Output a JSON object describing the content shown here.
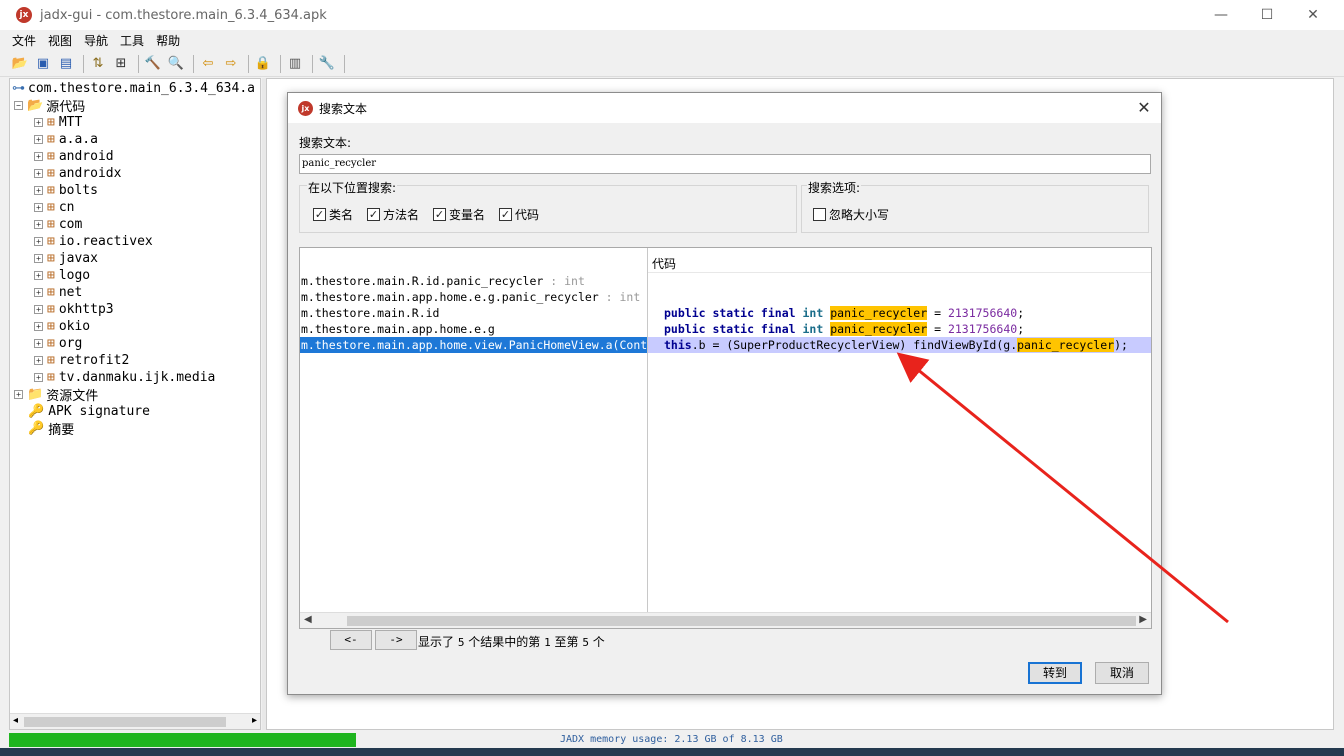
{
  "window": {
    "title": "jadx-gui - com.thestore.main_6.3.4_634.apk",
    "logo_text": "jx",
    "minimize": "—",
    "maximize": "☐",
    "close": "✕"
  },
  "menu": [
    "文件",
    "视图",
    "导航",
    "工具",
    "帮助"
  ],
  "tree": {
    "root": "com.thestore.main_6.3.4_634.a",
    "source_folder": "源代码",
    "packages": [
      "MTT",
      "a.a.a",
      "android",
      "androidx",
      "bolts",
      "cn",
      "com",
      "io.reactivex",
      "javax",
      "logo",
      "net",
      "okhttp3",
      "okio",
      "org",
      "retrofit2",
      "tv.danmaku.ijk.media"
    ],
    "resources": "资源文件",
    "apk_signature": "APK signature",
    "summary": "摘要"
  },
  "status": {
    "memory": "JADX memory usage: 2.13 GB of 8.13 GB",
    "memory_fraction": 0.262
  },
  "dialog": {
    "title": "搜索文本",
    "search_label": "搜索文本:",
    "search_value": "panic_recycler",
    "search_in_label": "在以下位置搜索:",
    "search_in": [
      {
        "label": "类名",
        "checked": true
      },
      {
        "label": "方法名",
        "checked": true
      },
      {
        "label": "变量名",
        "checked": true
      },
      {
        "label": "代码",
        "checked": true
      }
    ],
    "options_label": "搜索选项:",
    "options": [
      {
        "label": "忽略大小写",
        "checked": false
      }
    ],
    "code_column": "代码",
    "results": [
      {
        "node": "m.thestore.main.R.id.panic_recycler",
        "type": " : int"
      },
      {
        "node": "m.thestore.main.app.home.e.g.panic_recycler",
        "type": " : int"
      },
      {
        "node": "m.thestore.main.R.id",
        "type": ""
      },
      {
        "node": "m.thestore.main.app.home.e.g",
        "type": ""
      },
      {
        "node": "m.thestore.main.app.home.view.PanicHomeView.a(Cont",
        "type": ""
      }
    ],
    "code_lines": {
      "l1": {
        "kw1": "public static final",
        "ty": "int",
        "match": "panic_recycler",
        "rest": " = ",
        "num": "2131756640",
        "end": ";"
      },
      "l2": {
        "kw1": "public static final",
        "ty": "int",
        "match": "panic_recycler",
        "rest": " = ",
        "num": "2131756640",
        "end": ";"
      },
      "l3": {
        "kw": "this",
        "a": ".b = (SuperProductRecyclerView) findViewById(g.",
        "match": "panic_recycler",
        "end": ");"
      }
    },
    "prev_button": "<-",
    "next_button": "->",
    "results_info": {
      "p1": "显示了 ",
      "total": "5",
      "p2": " 个结果中的第 ",
      "from": "1",
      "p3": " 至第 ",
      "to": "5",
      "p4": " 个"
    },
    "goto_button": "转到",
    "cancel_button": "取消"
  }
}
